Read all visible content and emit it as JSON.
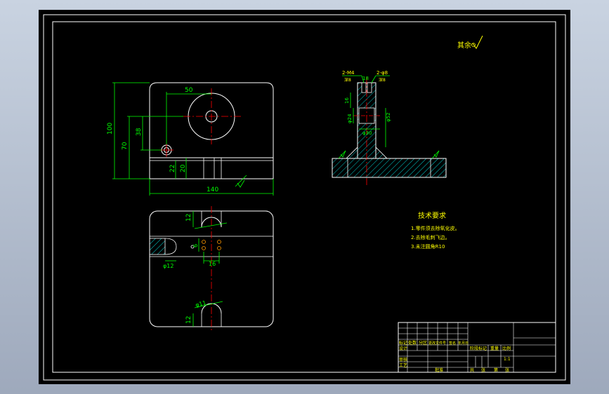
{
  "colors": {
    "background": "#000000",
    "line": "#ffffff",
    "dimension": "#00ff00",
    "centerline": "#ff0000",
    "text": "#ffff00",
    "hatch": "#00ffff",
    "window_gradient_top": "#c9d3e1"
  },
  "roughness_note": "其余",
  "front_view": {
    "dim_width": "140",
    "dim_height": "100",
    "dim_70": "70",
    "dim_38": "38",
    "dim_50": "50",
    "dim_22": "22",
    "dim_20": "20"
  },
  "top_view": {
    "dim_12_top": "12",
    "dim_12_bottom": "12",
    "dim_phi12": "φ12",
    "dim_phi11": "φ11",
    "dim_16": "16",
    "dim_6": "6"
  },
  "side_view": {
    "label_m4": "2-M4",
    "label_m4_sub": "深8",
    "label_phi8": "2-φ8",
    "label_phi8_sub": "深8",
    "dim_18": "18",
    "dim_16": "16",
    "dim_phi24": "φ24",
    "dim_phi52": "φ52",
    "dim_phi30": "φ30"
  },
  "tech_req": {
    "title": "技术要求",
    "items": [
      "1.零件须去除氧化皮。",
      "2.去除毛刺飞边。",
      "3.未注圆角R10"
    ]
  },
  "title_block": {
    "row_labels": [
      "标记",
      "设计",
      "审核",
      "工艺"
    ],
    "col_labels": [
      "处数",
      "分区",
      "更改文件号",
      "签名",
      "年月日"
    ],
    "stage_label": "阶段标记",
    "weight_label": "重量",
    "scale_label": "比例",
    "scale_value": "1:1",
    "sheet_labels": [
      "共",
      "张",
      "第",
      "张"
    ],
    "approve_label": "批准"
  }
}
